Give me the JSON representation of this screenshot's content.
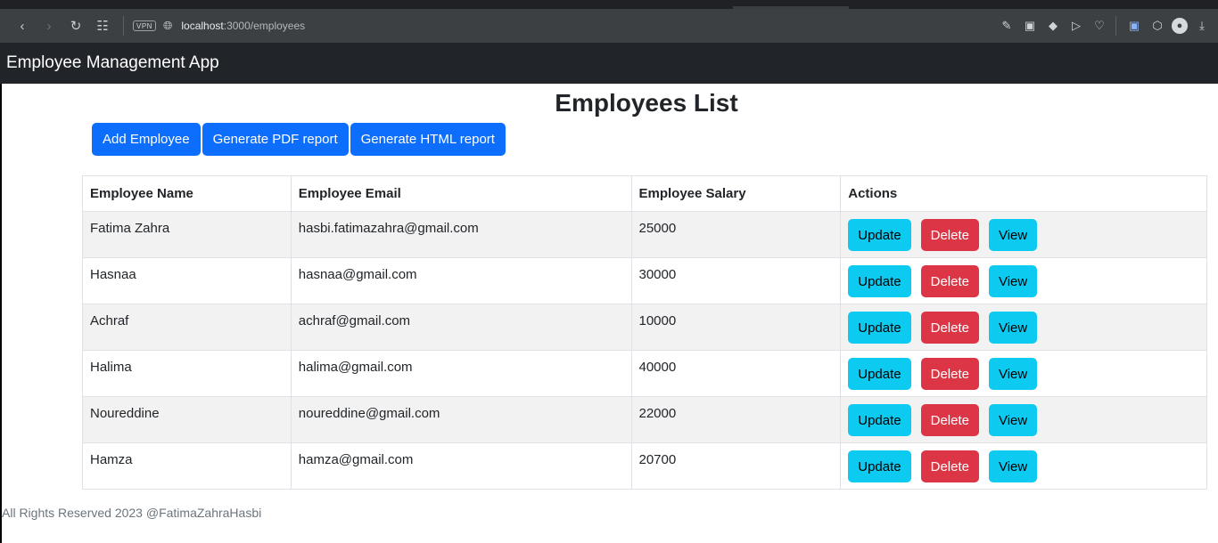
{
  "browser": {
    "url_host": "localhost",
    "url_path": ":3000/employees",
    "vpn_label": "VPN"
  },
  "header": {
    "brand": "Employee Management App"
  },
  "main": {
    "title": "Employees List",
    "buttons": {
      "add": "Add Employee",
      "pdf": "Generate PDF report",
      "html": "Generate HTML report"
    },
    "table": {
      "columns": [
        "Employee Name",
        "Employee Email",
        "Employee Salary",
        "Actions"
      ],
      "rows": [
        {
          "name": "Fatima Zahra",
          "email": "hasbi.fatimazahra@gmail.com",
          "salary": "25000"
        },
        {
          "name": "Hasnaa",
          "email": "hasnaa@gmail.com",
          "salary": "30000"
        },
        {
          "name": "Achraf",
          "email": "achraf@gmail.com",
          "salary": "10000"
        },
        {
          "name": "Halima",
          "email": "halima@gmail.com",
          "salary": "40000"
        },
        {
          "name": "Noureddine",
          "email": "noureddine@gmail.com",
          "salary": "22000"
        },
        {
          "name": "Hamza",
          "email": "hamza@gmail.com",
          "salary": "20700"
        }
      ],
      "actions": {
        "update": "Update",
        "delete": "Delete",
        "view": "View"
      }
    }
  },
  "footer": {
    "text": "All Rights Reserved 2023 @FatimaZahraHasbi"
  },
  "colors": {
    "primary": "#0d6efd",
    "info": "#0dcaf0",
    "danger": "#dc3545",
    "navbar": "#212529"
  }
}
